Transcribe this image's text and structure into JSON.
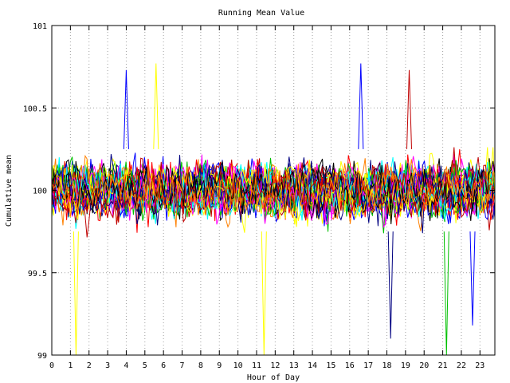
{
  "chart_data": {
    "type": "line",
    "title": "Running Mean Value",
    "xlabel": "Hour of Day",
    "ylabel": "Cumulative mean",
    "xlim": [
      0,
      23.8
    ],
    "ylim": [
      99,
      101
    ],
    "x_ticks": [
      "0",
      "1",
      "2",
      "3",
      "4",
      "5",
      "6",
      "7",
      "8",
      "9",
      "10",
      "11",
      "12",
      "13",
      "14",
      "15",
      "16",
      "17",
      "18",
      "19",
      "20",
      "21",
      "22",
      "23"
    ],
    "y_ticks": [
      "99",
      "99.5",
      "100",
      "100.5",
      "101"
    ],
    "grid": true,
    "legend": "none",
    "series_count": 40,
    "points_per_series": 240,
    "center_value": 100,
    "typical_band": [
      99.6,
      100.4
    ],
    "series_colors": [
      "#0000ff",
      "#ff0000",
      "#00c000",
      "#ff00ff",
      "#00ffff",
      "#ffff00",
      "#000080",
      "#c00000",
      "#000000",
      "#ff8000"
    ],
    "notable_extremes": [
      {
        "x": 1.3,
        "y": 99.0,
        "color": "#ffff00"
      },
      {
        "x": 11.4,
        "y": 99.0,
        "color": "#ffff00"
      },
      {
        "x": 21.2,
        "y": 99.0,
        "color": "#00c000"
      },
      {
        "x": 18.2,
        "y": 99.1,
        "color": "#000080"
      },
      {
        "x": 22.6,
        "y": 99.18,
        "color": "#0000ff"
      },
      {
        "x": 5.6,
        "y": 100.77,
        "color": "#ffff00"
      },
      {
        "x": 4.0,
        "y": 100.73,
        "color": "#0000ff"
      },
      {
        "x": 19.2,
        "y": 100.73,
        "color": "#c00000"
      },
      {
        "x": 16.6,
        "y": 100.77,
        "color": "#0000ff"
      }
    ]
  }
}
